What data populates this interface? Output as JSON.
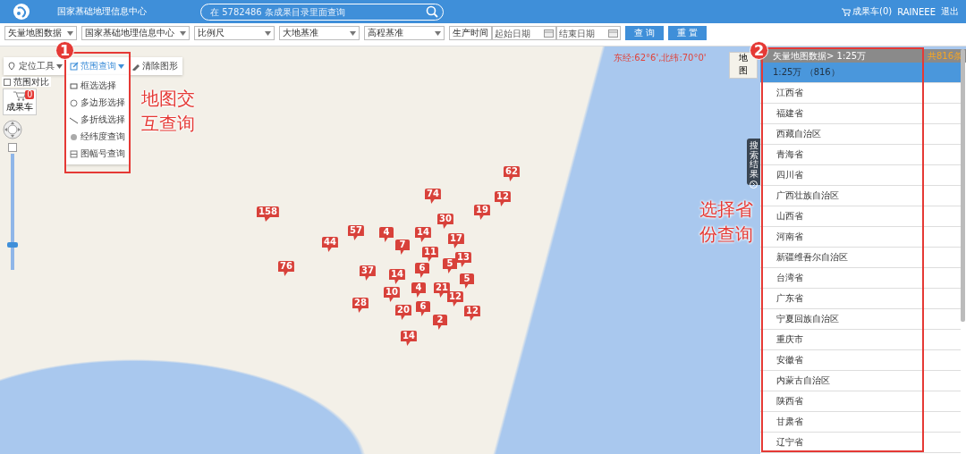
{
  "header": {
    "title": "国家基础地理信息中心",
    "search": {
      "placeholder": "在 5782486 条成果目录里面查询"
    },
    "cart": "成果车(0)",
    "user": "RAINEEE",
    "logout": "退出"
  },
  "filters": {
    "selects": [
      {
        "value": "矢量地图数据"
      },
      {
        "value": "国家基础地理信息中心"
      },
      {
        "value": "比例尺"
      },
      {
        "value": "大地基准"
      },
      {
        "value": "高程基准"
      }
    ],
    "time_label": "生产时间",
    "start_date": {
      "placeholder": "起始日期"
    },
    "end_date": {
      "placeholder": "结束日期"
    },
    "buttons": [
      "查 询",
      "重 置"
    ]
  },
  "map": {
    "coordinates": "东经:62°6',北纬:70°0'",
    "layer_button": "地图",
    "tools": [
      {
        "label": "定位工具",
        "kind": "dropdown",
        "selected": false
      },
      {
        "label": "范围查询",
        "kind": "dropdown",
        "selected": true
      },
      {
        "label": "清除图形",
        "kind": "button",
        "selected": false
      }
    ],
    "query_menu": [
      {
        "label": "框选选择",
        "kind": "rectangle"
      },
      {
        "label": "多边形选择",
        "kind": "polygon"
      },
      {
        "label": "多折线选择",
        "kind": "polyline"
      },
      {
        "label": "经纬度查询",
        "kind": "coordinate"
      },
      {
        "label": "图幅号查询",
        "kind": "sheet"
      }
    ],
    "compare": {
      "label": "范围对比",
      "checked": false
    },
    "cart": {
      "label": "成果车",
      "count": "0"
    },
    "zoom": {
      "level": 0.2
    },
    "search_tab": "搜索结果",
    "markers": [
      {
        "count": "62"
      },
      {
        "count": "74"
      },
      {
        "count": "12"
      },
      {
        "count": "19"
      },
      {
        "count": "158"
      },
      {
        "count": "30"
      },
      {
        "count": "57"
      },
      {
        "count": "4"
      },
      {
        "count": "14"
      },
      {
        "count": "17"
      },
      {
        "count": "44"
      },
      {
        "count": "7"
      },
      {
        "count": "11"
      },
      {
        "count": "13"
      },
      {
        "count": "5"
      },
      {
        "count": "76"
      },
      {
        "count": "37"
      },
      {
        "count": "14"
      },
      {
        "count": "6"
      },
      {
        "count": "5"
      },
      {
        "count": "4"
      },
      {
        "count": "21"
      },
      {
        "count": "10"
      },
      {
        "count": "12"
      },
      {
        "count": "28"
      },
      {
        "count": "20"
      },
      {
        "count": "6"
      },
      {
        "count": "2"
      },
      {
        "count": "12"
      },
      {
        "count": "14"
      }
    ]
  },
  "results": {
    "path": "矢量地图数据> 1:25万",
    "total": "共816条",
    "items": [
      {
        "label": "1:25万 （816）",
        "selected": true
      },
      {
        "label": "江西省",
        "selected": false
      },
      {
        "label": "福建省",
        "selected": false
      },
      {
        "label": "西藏自治区",
        "selected": false
      },
      {
        "label": "青海省",
        "selected": false
      },
      {
        "label": "四川省",
        "selected": false
      },
      {
        "label": "广西壮族自治区",
        "selected": false
      },
      {
        "label": "山西省",
        "selected": false
      },
      {
        "label": "河南省",
        "selected": false
      },
      {
        "label": "新疆维吾尔自治区",
        "selected": false
      },
      {
        "label": "台湾省",
        "selected": false
      },
      {
        "label": "广东省",
        "selected": false
      },
      {
        "label": "宁夏回族自治区",
        "selected": false
      },
      {
        "label": "重庆市",
        "selected": false
      },
      {
        "label": "安徽省",
        "selected": false
      },
      {
        "label": "内蒙古自治区",
        "selected": false
      },
      {
        "label": "陕西省",
        "selected": false
      },
      {
        "label": "甘肃省",
        "selected": false
      },
      {
        "label": "辽宁省",
        "selected": false
      }
    ]
  },
  "annotations": [
    {
      "number": "1",
      "text": "地图交互查询"
    },
    {
      "number": "2",
      "text": "选择省份查询"
    }
  ]
}
